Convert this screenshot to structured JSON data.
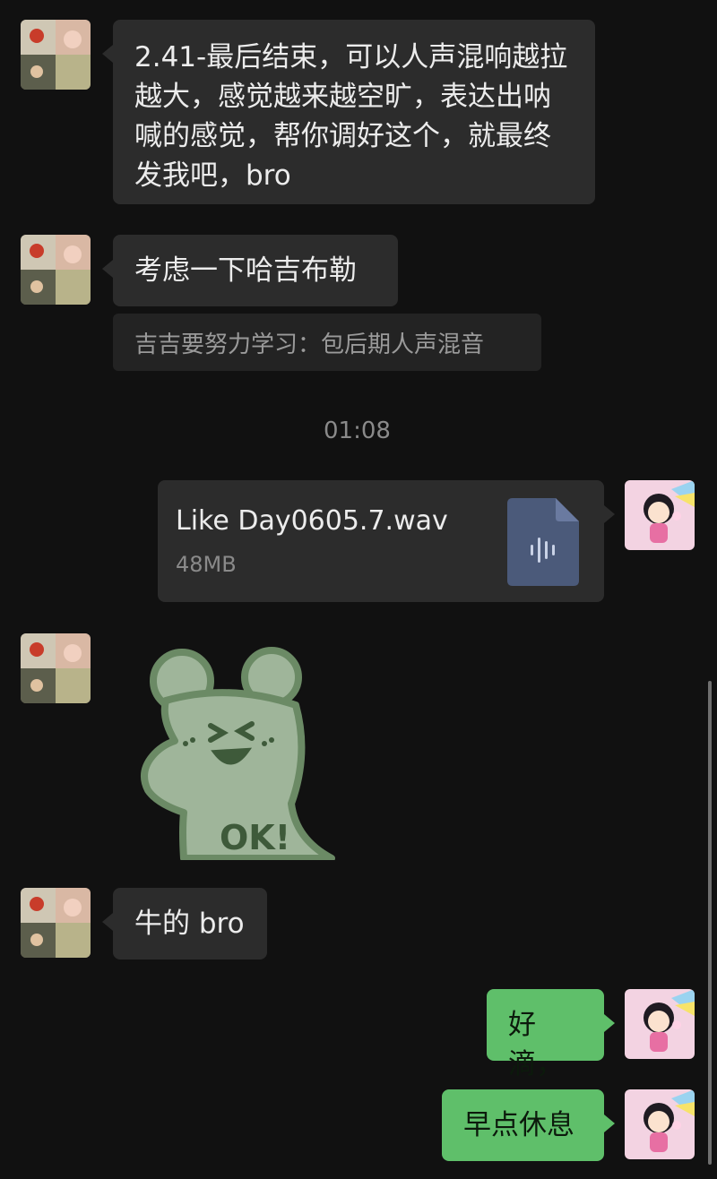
{
  "messages": {
    "m1": {
      "text": "2.41-最后结束，可以人声混响越拉越大，感觉越来越空旷，表达出呐喊的感觉，帮你调好这个，就最终发我吧，bro"
    },
    "m2": {
      "text": "考虑一下哈吉布勒"
    },
    "quote": {
      "text": "吉吉要努力学习：包后期人声混音"
    },
    "timestamp": "01:08",
    "file": {
      "name": "Like Day0605.7.wav",
      "size": "48MB",
      "icon": "audio-file-icon"
    },
    "sticker": {
      "icon": "ok-bear-sticker",
      "text": "OK!"
    },
    "m3": {
      "text": "牛的 bro"
    },
    "m4": {
      "text": "好滴，"
    },
    "m5": {
      "text": "早点休息"
    }
  },
  "colors": {
    "background": "#111111",
    "bubble_dark": "#2c2c2c",
    "bubble_green": "#5fbf6a"
  }
}
